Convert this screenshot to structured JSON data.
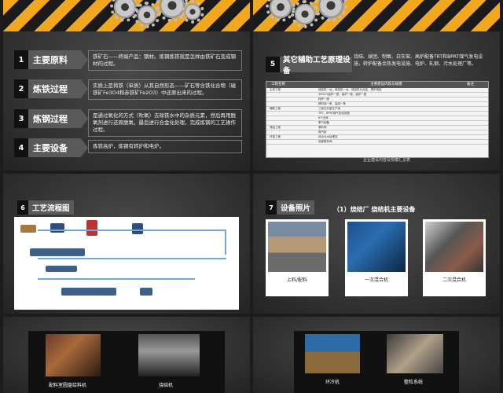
{
  "slide1": {
    "items": [
      {
        "num": "1",
        "title": "主要原料",
        "desc": "铁矿石——终端产品：钢材。炼钢炼铁就是怎样由铁矿石变成钢材的过程。"
      },
      {
        "num": "2",
        "title": "炼铁过程",
        "desc": "实质上是将铁（单质）从其自然形态——矿石等含铁化合物（磁铁矿Fe3O4和赤铁矿Fe2O3）中还原出来的过程。"
      },
      {
        "num": "3",
        "title": "炼钢过程",
        "desc": "是通过氧化的方式（吹氧）去除铁水中的杂质元素，然后再用脱氧剂进行还原脱氧，最后进行合金化处理，完成炼钢的工艺操作过程。"
      },
      {
        "num": "4",
        "title": "主要设备",
        "desc": "炼铁高炉，炼钢有转炉和电炉。"
      }
    ]
  },
  "slide2": {
    "num": "5",
    "title": "其它辅助工艺原理设备",
    "desc": "烧结、球团、制氧、白灰窑、高炉配备TRT和BPRT煤气发电设施，转炉配备余热发电设施、电炉、轧钢、污水处理厂等。",
    "table_headers": [
      "工程名称",
      "主要建设内容与规模",
      "备注"
    ],
    "table_rows": [
      [
        "主体工程",
        "烧结机一台、烧结机一台、烧结机为合金、提炉烧结",
        ""
      ],
      [
        "",
        "450m3高炉一座、高炉一座、高炉一座",
        ""
      ],
      [
        "",
        "转炉一座",
        ""
      ],
      [
        "",
        "棒材线一条、高线一条",
        ""
      ],
      [
        "辅助工程",
        "三座石灰窑生产线",
        ""
      ],
      [
        "",
        "TRT、BPRT煤气发电设施",
        ""
      ],
      [
        "",
        "8个仓库",
        ""
      ],
      [
        "",
        "氧气制备",
        ""
      ],
      [
        "储运工程",
        "原料场",
        ""
      ],
      [
        "",
        "煤气柜",
        ""
      ],
      [
        "环保工程",
        "综合污水处理站",
        ""
      ],
      [
        "",
        "危废暂存间",
        ""
      ]
    ],
    "footer": "企业建设内容及规模汇总表"
  },
  "slide3": {
    "num": "6",
    "title": "工艺流程图"
  },
  "slide4": {
    "num": "7",
    "title": "设备照片",
    "subtitle": "（1）烧结厂 烧结机主要设备",
    "photos": [
      {
        "caption": "上料/配料"
      },
      {
        "caption": "一次混合机"
      },
      {
        "caption": "二次混合机"
      }
    ]
  },
  "slide5": {
    "photos": [
      {
        "caption": "配料室圆盘给料机"
      },
      {
        "caption": "烧结机"
      }
    ]
  },
  "slide6": {
    "photos": [
      {
        "caption": "环冷机"
      },
      {
        "caption": "整粒系统"
      }
    ]
  },
  "colors": {
    "stripe_yellow": "#f2a81d",
    "stripe_black": "#1a1a1a",
    "dark_bg": "#3b3b3b"
  }
}
